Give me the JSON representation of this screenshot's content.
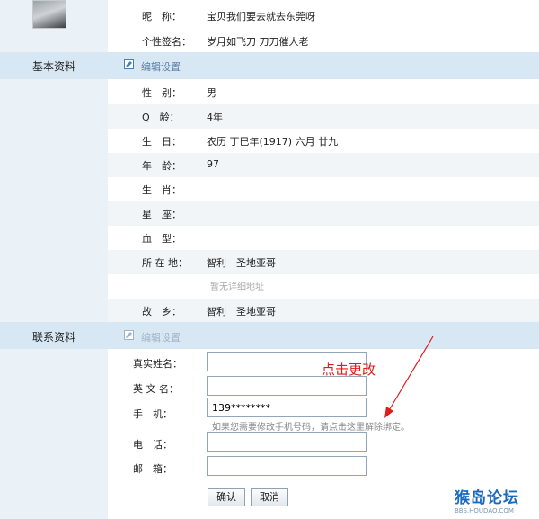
{
  "profile_top": {
    "nickname_label": "昵　称：",
    "nickname_value": "宝贝我们要去就去东莞呀",
    "signature_label": "个性签名：",
    "signature_value": "岁月如飞刀 刀刀催人老"
  },
  "basic": {
    "section_title": "基本资料",
    "edit_label": "编辑设置",
    "fields": [
      {
        "label": "性　别：",
        "value": "男"
      },
      {
        "label": "Q　龄：",
        "value": "4年"
      },
      {
        "label": "生　日：",
        "value": "农历  丁巳年(1917) 六月 廿九"
      },
      {
        "label": "年　龄：",
        "value": "97"
      },
      {
        "label": "生　肖：",
        "value": ""
      },
      {
        "label": "星　座：",
        "value": ""
      },
      {
        "label": "血　型：",
        "value": ""
      },
      {
        "label": "所 在 地：",
        "value": "智利　圣地亚哥"
      },
      {
        "label": "",
        "value": ""
      },
      {
        "label": "故　乡：",
        "value": "智利　圣地亚哥"
      }
    ],
    "address_placeholder": "暂无详细地址"
  },
  "contact": {
    "section_title": "联系资料",
    "edit_label": "编辑设置",
    "realname_label": "真实姓名：",
    "realname_value": "",
    "englishname_label": "英 文 名：",
    "englishname_value": "",
    "mobile_label": "手　机：",
    "mobile_value": "139********",
    "mobile_hint": "如果您需要修改手机号码，请点击这里解除绑定。",
    "phone_label": "电　话：",
    "phone_value": "",
    "email_label": "邮　箱：",
    "email_value": "",
    "confirm_label": "确认",
    "cancel_label": "取消"
  },
  "annotation": {
    "text": "点击更改",
    "color": "#e11a1a"
  },
  "watermark": {
    "main": "猴岛论坛",
    "sub": "BBS.HOUDAO.COM"
  },
  "colors": {
    "section_band": "#d7e7f3",
    "left_column": "#eaf1f7",
    "alt_row": "#f1f5f8"
  }
}
